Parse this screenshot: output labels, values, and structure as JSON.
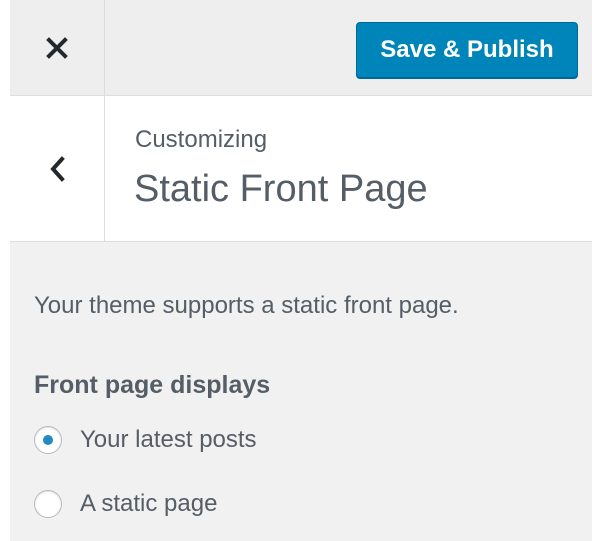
{
  "header": {
    "close_icon": "close-icon",
    "save_label": "Save & Publish",
    "accent_color": "#0085ba"
  },
  "section": {
    "back_icon": "chevron-left-icon",
    "eyebrow": "Customizing",
    "title": "Static Front Page"
  },
  "content": {
    "description": "Your theme supports a static front page.",
    "group_label": "Front page displays",
    "options": [
      {
        "label": "Your latest posts",
        "checked": true
      },
      {
        "label": "A static page",
        "checked": false
      }
    ]
  }
}
